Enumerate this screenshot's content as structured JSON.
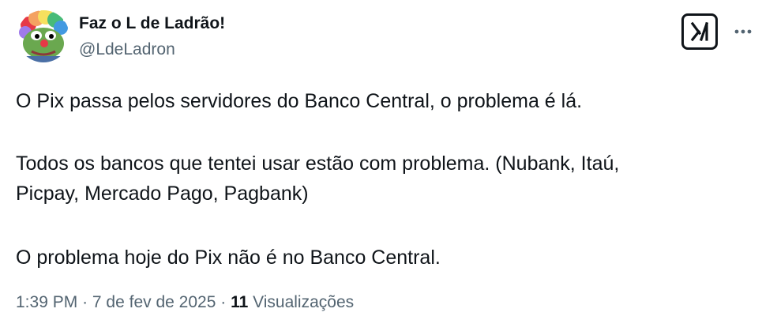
{
  "author": {
    "display_name": "Faz o L de Ladrão!",
    "handle": "@LdeLadron"
  },
  "tweet": {
    "lines": [
      "O Pix passa pelos servidores do Banco Central, o problema é lá.",
      "Todos os bancos que tentei usar estão com problema. (Nubank, Itaú,",
      "Picpay, Mercado Pago, Pagbank)",
      "O problema hoje do Pix não é  no Banco Central."
    ],
    "time": "1:39 PM",
    "separator": "·",
    "date": "7 de fev de 2025",
    "views_count": "11",
    "views_label": "Visualizações"
  },
  "icons": {
    "grok": "grok-icon",
    "more": "more-icon",
    "avatar": "clown-frog-avatar"
  },
  "colors": {
    "text_primary": "#0f1419",
    "text_secondary": "#536471",
    "background": "#ffffff"
  }
}
